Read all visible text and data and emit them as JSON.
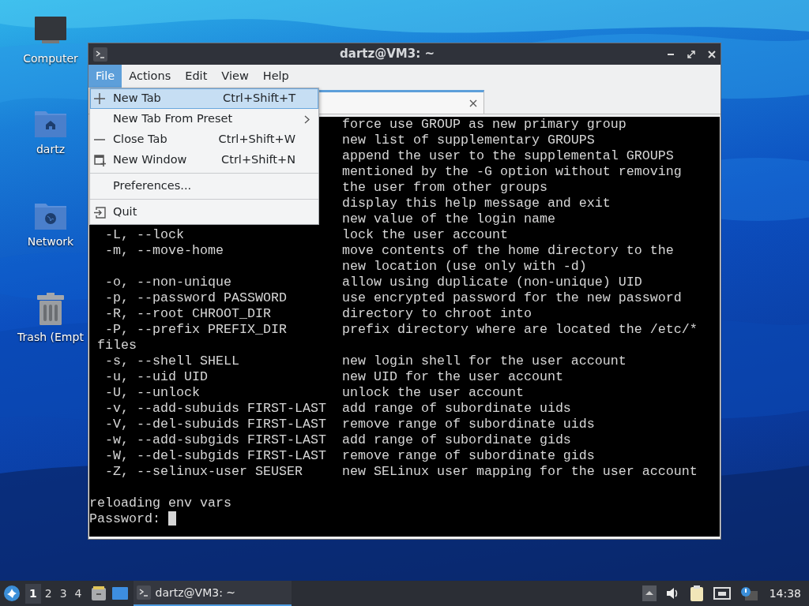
{
  "desktop_icons": [
    {
      "label": "Computer",
      "kind": "computer"
    },
    {
      "label": "dartz",
      "kind": "home"
    },
    {
      "label": "Network",
      "kind": "network"
    },
    {
      "label": "Trash (Empt",
      "kind": "trash"
    }
  ],
  "window": {
    "title": "dartz@VM3: ~",
    "menu": [
      {
        "label": "File",
        "selected": true
      },
      {
        "label": "Actions",
        "selected": false
      },
      {
        "label": "Edit",
        "selected": false
      },
      {
        "label": "View",
        "selected": false
      },
      {
        "label": "Help",
        "selected": false
      }
    ],
    "file_menu": [
      {
        "kind": "add",
        "label": "New Tab",
        "shortcut": "Ctrl+Shift+T",
        "selected": true
      },
      {
        "kind": "submenu",
        "label": "New Tab From Preset",
        "selected": false
      },
      {
        "kind": "remove",
        "label": "Close Tab",
        "shortcut": "Ctrl+Shift+W",
        "selected": false
      },
      {
        "kind": "window",
        "label": "New Window",
        "shortcut": "Ctrl+Shift+N",
        "selected": false
      },
      {
        "kind": "separator"
      },
      {
        "kind": "plain",
        "label": "Preferences...",
        "selected": false
      },
      {
        "kind": "separator"
      },
      {
        "kind": "exit",
        "label": "Quit",
        "selected": false
      }
    ],
    "terminal": [
      {
        "kind": "option",
        "description": "force use GROUP as new primary group"
      },
      {
        "kind": "option",
        "description": "new list of supplementary GROUPS"
      },
      {
        "kind": "option",
        "description": "append the user to the supplemental GROUPS"
      },
      {
        "kind": "option",
        "description": "mentioned by the -G option without removing"
      },
      {
        "kind": "option",
        "description": "the user from other groups"
      },
      {
        "kind": "option",
        "description": "display this help message and exit"
      },
      {
        "kind": "option",
        "description": "new value of the login name"
      },
      {
        "kind": "option",
        "option": "-L, --lock",
        "description": "lock the user account"
      },
      {
        "kind": "option",
        "option": "-m, --move-home",
        "description": "move contents of the home directory to the"
      },
      {
        "kind": "option",
        "description": "new location (use only with -d)"
      },
      {
        "kind": "option",
        "option": "-o, --non-unique",
        "description": "allow using duplicate (non-unique) UID"
      },
      {
        "kind": "option",
        "option": "-p, --password PASSWORD",
        "description": "use encrypted password for the new password"
      },
      {
        "kind": "option",
        "option": "-R, --root CHROOT_DIR",
        "description": "directory to chroot into"
      },
      {
        "kind": "option",
        "option": "-P, --prefix PREFIX_DIR",
        "description": "prefix directory where are located the /etc/*"
      },
      {
        "kind": "wrap",
        "text": "files"
      },
      {
        "kind": "option",
        "option": "-s, --shell SHELL",
        "description": "new login shell for the user account"
      },
      {
        "kind": "option",
        "option": "-u, --uid UID",
        "description": "new UID for the user account"
      },
      {
        "kind": "option",
        "option": "-U, --unlock",
        "description": "unlock the user account"
      },
      {
        "kind": "option",
        "option": "-v, --add-subuids FIRST-LAST",
        "description": "add range of subordinate uids"
      },
      {
        "kind": "option",
        "option": "-V, --del-subuids FIRST-LAST",
        "description": "remove range of subordinate uids"
      },
      {
        "kind": "option",
        "option": "-w, --add-subgids FIRST-LAST",
        "description": "add range of subordinate gids"
      },
      {
        "kind": "option",
        "option": "-W, --del-subgids FIRST-LAST",
        "description": "remove range of subordinate gids"
      },
      {
        "kind": "option",
        "option": "-Z, --selinux-user SEUSER",
        "description": "new SELinux user mapping for the user account"
      },
      {
        "kind": "blank"
      },
      {
        "kind": "text",
        "text": "reloading env vars"
      },
      {
        "kind": "prompt",
        "text": "Password:"
      }
    ]
  },
  "taskbar": {
    "workspaces": [
      {
        "label": "1",
        "selected": true
      },
      {
        "label": "2",
        "selected": false
      },
      {
        "label": "3",
        "selected": false
      },
      {
        "label": "4",
        "selected": false
      }
    ],
    "tasks": [
      {
        "label": "dartz@VM3: ~",
        "selected": true
      }
    ],
    "clock": "14:38"
  }
}
